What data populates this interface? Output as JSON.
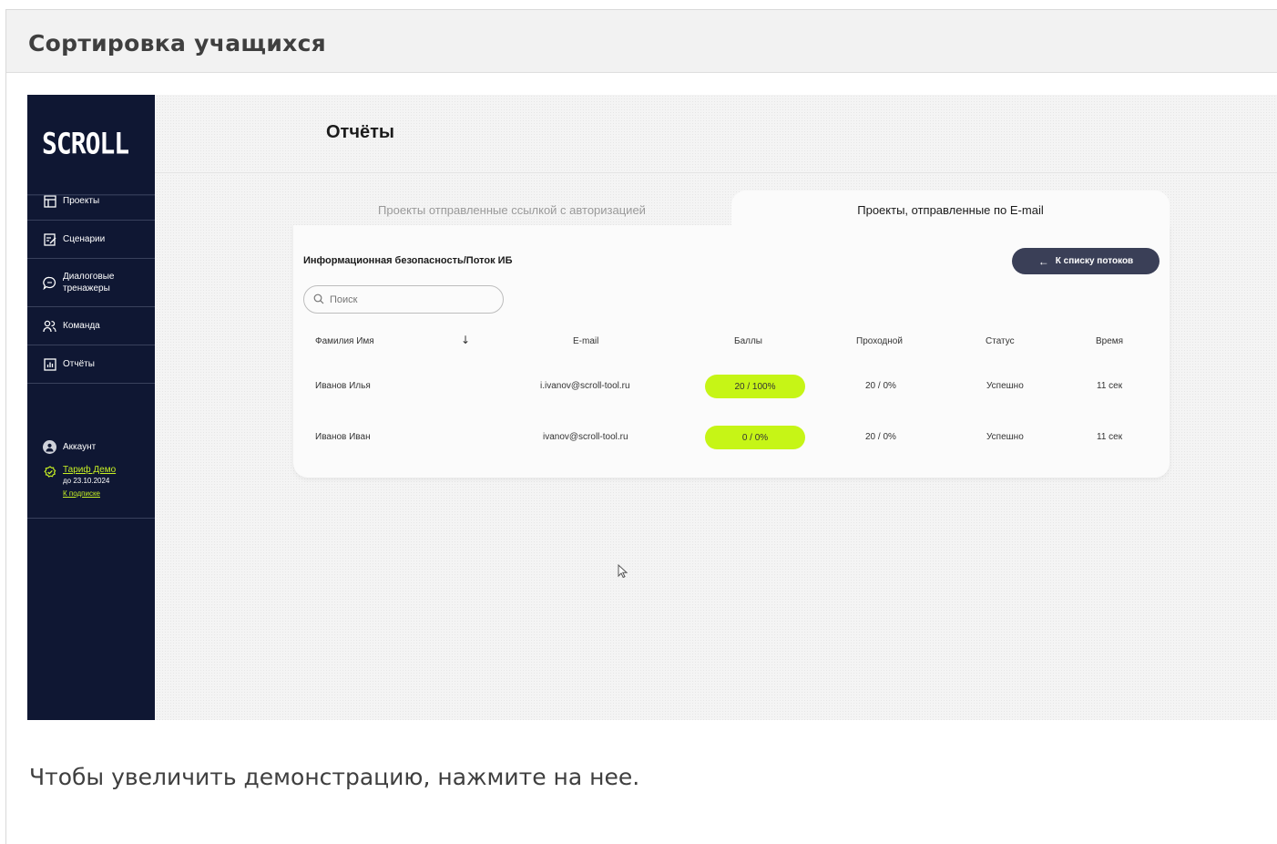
{
  "frame_title": "Сортировка учащихся",
  "caption": "Чтобы увеличить демонстрацию, нажмите на нее.",
  "app": {
    "logo": "SCROLL",
    "page_title": "Отчёты",
    "nav": [
      {
        "label": "Проекты",
        "icon": "layout-icon"
      },
      {
        "label": "Сценарии",
        "icon": "edit-icon"
      },
      {
        "label": "Диалоговые тренажеры",
        "icon": "chat-icon"
      },
      {
        "label": "Команда",
        "icon": "team-icon"
      },
      {
        "label": "Отчёты",
        "icon": "report-icon"
      }
    ],
    "account": {
      "label": "Аккаунт",
      "tariff": "Тариф Демо",
      "tariff_until": "до 23.10.2024",
      "subscription_link": "К подписке"
    },
    "tabs": {
      "inactive": "Проекты отправленные ссылкой с авторизацией",
      "active": "Проекты, отправленные по E-mail"
    },
    "card_title": "Информационная безопасность/Поток ИБ",
    "back_button": "К списку потоков",
    "search_placeholder": "Поиск",
    "table": {
      "headers": [
        "Фамилия Имя",
        "E-mail",
        "Баллы",
        "Проходной",
        "Статус",
        "Время"
      ],
      "rows": [
        {
          "name": "Иванов Илья",
          "email": "i.ivanov@scroll-tool.ru",
          "score": "20 / 100%",
          "pass": "20 / 0%",
          "status": "Успешно",
          "time": "11 сек"
        },
        {
          "name": "Иванов Иван",
          "email": "ivanov@scroll-tool.ru",
          "score": "0 / 0%",
          "pass": "20 / 0%",
          "status": "Успешно",
          "time": "11 сек"
        }
      ]
    },
    "colors": {
      "sidebar": "#0f1733",
      "accent": "#c6f516",
      "button": "#3a3f57"
    }
  }
}
